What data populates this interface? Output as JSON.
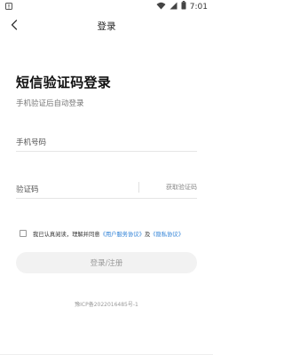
{
  "status_bar": {
    "time": "7:01",
    "icons": [
      "alert-icon",
      "wifi-icon",
      "signal-icon",
      "battery-icon"
    ]
  },
  "nav": {
    "title": "登录",
    "back_icon": "chevron-left-icon"
  },
  "page": {
    "title": "短信验证码登录",
    "subtitle": "手机验证后自动登录"
  },
  "form": {
    "phone_placeholder": "手机号码",
    "code_placeholder": "验证码",
    "get_code_label": "获取验证码"
  },
  "agreement": {
    "prefix": "我已认真阅读，理解并同意",
    "user_agreement": "《用户服务协议》",
    "and": "及",
    "privacy_policy": "《隐私协议》"
  },
  "login_button": "登录/注册",
  "footer": {
    "icp": "豫ICP备2022016485号-1"
  },
  "colors": {
    "link": "#2b7fd6",
    "button_bg": "#f2f2f2",
    "button_text": "#9a9a9a"
  }
}
